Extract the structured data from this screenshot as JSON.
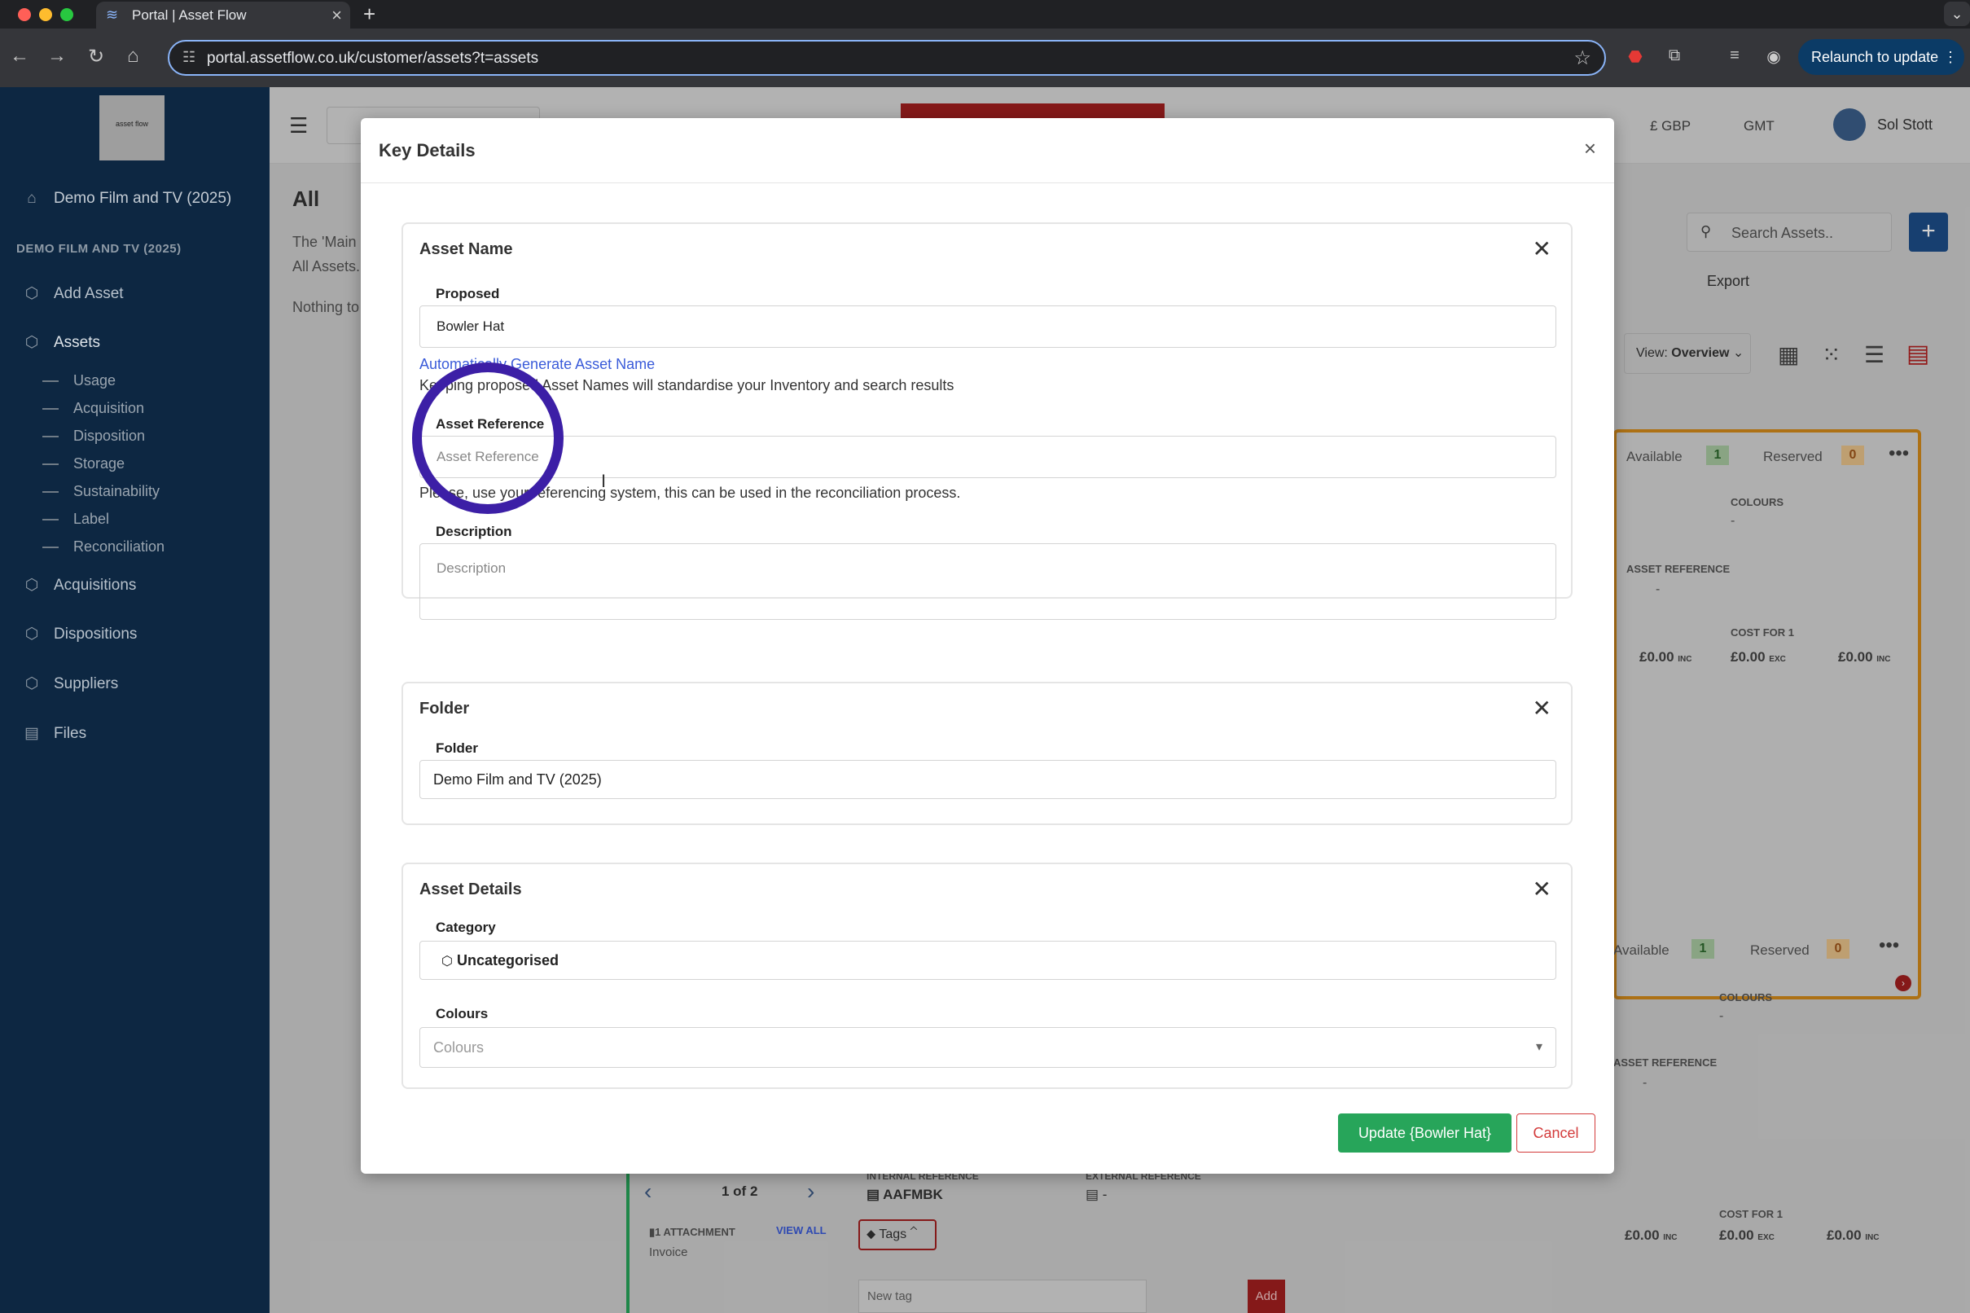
{
  "browser": {
    "tab_title": "Portal | Asset Flow",
    "url": "portal.assetflow.co.uk/customer/assets?t=assets",
    "relaunch_label": "Relaunch to update"
  },
  "sidebar": {
    "home_label": "Demo Film and TV (2025)",
    "section_title": "DEMO FILM AND TV (2025)",
    "add_asset": "Add Asset",
    "assets": "Assets",
    "sub_items": [
      "Usage",
      "Acquisition",
      "Disposition",
      "Storage",
      "Sustainability",
      "Label",
      "Reconciliation"
    ],
    "acquisitions": "Acquisitions",
    "dispositions": "Dispositions",
    "suppliers": "Suppliers",
    "files": "Files"
  },
  "header": {
    "currency": "£ GBP",
    "timezone": "GMT",
    "user": "Sol Stott"
  },
  "background": {
    "page_heading": "All",
    "intro_line1": "The 'Main",
    "intro_line2": "All Assets.",
    "nothing": "Nothing to",
    "search_placeholder": "Search Assets..",
    "export": "Export",
    "view_label": "View:",
    "view_value": "Overview",
    "card1": {
      "available": "Available",
      "available_count": "1",
      "reserved": "Reserved",
      "reserved_count": "0",
      "colours": "COLOURS",
      "colours_val": "-",
      "asset_ref": "ASSET REFERENCE",
      "asset_ref_val": "-",
      "cost_for": "COST FOR 1",
      "price1": "£0.00",
      "price1_suffix": "INC",
      "price2": "£0.00",
      "price2_suffix": "EXC",
      "price3": "£0.00",
      "price3_suffix": "INC"
    },
    "card2": {
      "available": "Available",
      "available_count": "1",
      "reserved": "Reserved",
      "reserved_count": "0",
      "colours": "COLOURS",
      "colours_val": "-",
      "asset_ref": "ASSET REFERENCE",
      "asset_ref_val": "-",
      "cost_for": "COST FOR 1",
      "price1": "£0.00",
      "price1_suffix": "INC",
      "price2": "£0.00",
      "price2_suffix": "EXC",
      "price3": "£0.00",
      "price3_suffix": "INC"
    },
    "pager": "1 of 2",
    "internal_ref_label": "INTERNAL REFERENCE",
    "internal_ref_value": "AAFMBK",
    "external_ref_label": "EXTERNAL REFERENCE",
    "external_ref_value": "-",
    "attachment": "1 ATTACHMENT",
    "view_all": "VIEW ALL",
    "invoice": "Invoice",
    "tags": "Tags",
    "new_tag_placeholder": "New tag",
    "add": "Add"
  },
  "modal": {
    "title": "Key Details",
    "asset_name_panel": {
      "title": "Asset Name",
      "proposed_label": "Proposed",
      "proposed_value": "Bowler Hat",
      "auto_link": "Automatically Generate Asset Name",
      "hint": "Keeping proposed Asset Names will standardise your Inventory and search results",
      "ref_label": "Asset Reference",
      "ref_placeholder": "Asset Reference",
      "ref_hint": "Please, use your referencing system, this can be used in the reconciliation process.",
      "desc_label": "Description",
      "desc_placeholder": "Description"
    },
    "folder_panel": {
      "title": "Folder",
      "folder_label": "Folder",
      "folder_value": "Demo Film and TV (2025)"
    },
    "details_panel": {
      "title": "Asset Details",
      "category_label": "Category",
      "category_value": "Uncategorised",
      "colours_label": "Colours",
      "colours_placeholder": "Colours"
    },
    "update_button": "Update {Bowler Hat}",
    "cancel_button": "Cancel"
  },
  "colors": {
    "sidebar_bg": "#0d2742",
    "update_green": "#27a55a",
    "cancel_red": "#d33b3b",
    "highlight_ring": "#3c1fa6",
    "link_blue": "#3a5bd9"
  }
}
